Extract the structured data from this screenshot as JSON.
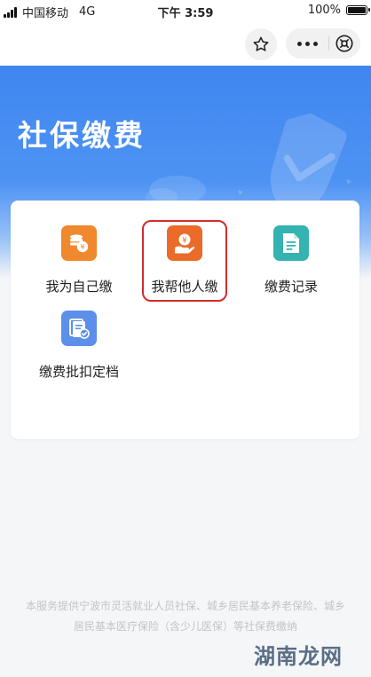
{
  "status_bar": {
    "carrier": "中国移动",
    "network": "4G",
    "time": "下午 3:59",
    "battery": "100%",
    "battery_level": 1.0
  },
  "nav": {
    "favorite_icon": "star-outline-icon",
    "more_icon": "more-dots-icon",
    "close_icon": "close-circle-icon"
  },
  "hero": {
    "title": "社保缴费"
  },
  "menu": {
    "items": [
      {
        "label": "我为自己缴",
        "icon": "coins-yuan-icon",
        "color": "#f0882d"
      },
      {
        "label": "我帮他人缴",
        "icon": "hand-yuan-icon",
        "color": "#ea6b2a"
      },
      {
        "label": "缴费记录",
        "icon": "document-icon",
        "color": "#34b3b0"
      },
      {
        "label": "缴费批扣定档",
        "icon": "file-check-icon",
        "color": "#5b8fea"
      }
    ],
    "highlight_color": "#d42b2b"
  },
  "footer": {
    "line1": "本服务提供宁波市灵活就业人员社保、城乡居民基本养老保险、城乡",
    "line2": "居民基本医疗保险（含少儿医保）等社保费缴纳"
  },
  "watermark": "湖南龙网"
}
